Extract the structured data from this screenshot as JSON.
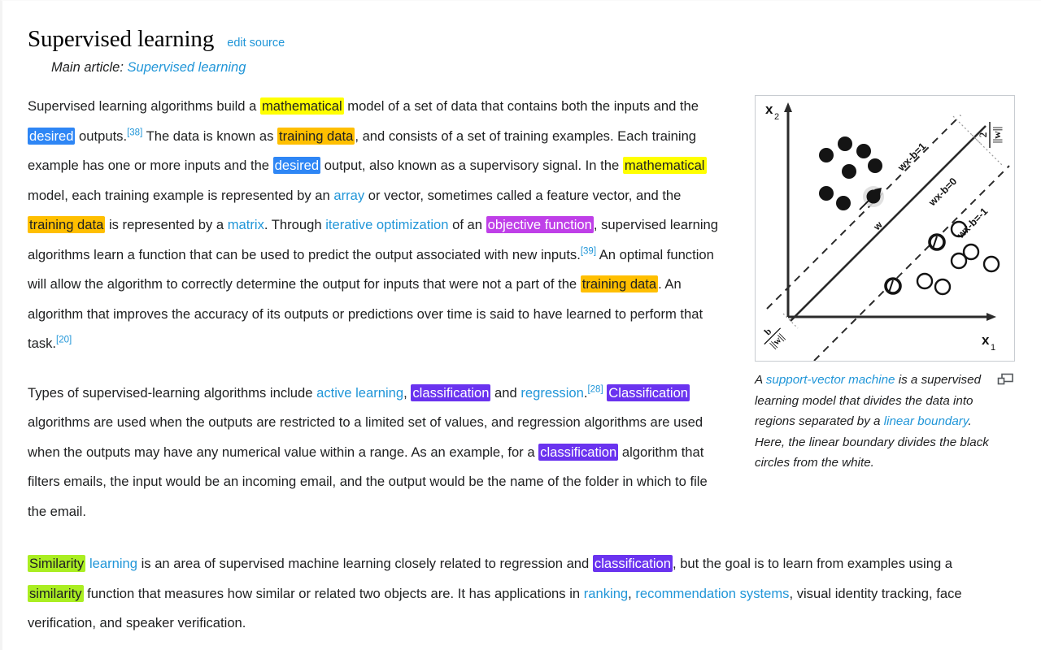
{
  "section": {
    "title": "Supervised learning",
    "edit_link": "edit source",
    "hatnote_prefix": "Main article:",
    "hatnote_link": "Supervised learning"
  },
  "paragraph1": {
    "s1": "Supervised learning algorithms build a ",
    "hl_mathematical_1": "mathematical",
    "s2": " model of a set of data that contains both the inputs and the ",
    "hl_desired_1": "desired",
    "s3": " outputs.",
    "ref38": "[38]",
    "s4": " The data is known as ",
    "hl_training_data_1": "training data",
    "s5": ", and consists of a set of training examples. Each training example has one or more inputs and the ",
    "hl_desired_2": "desired",
    "s6": " output, also known as a supervisory signal. In the ",
    "hl_mathematical_2": "mathematical",
    "s7": " model, each training example is represented by an ",
    "link_array": "array",
    "s8": " or vector, sometimes called a feature vector, and the ",
    "hl_training_data_2": "training data",
    "s9": " is represented by a ",
    "link_matrix": "matrix",
    "s10": ". Through ",
    "link_iterative_optimization": "iterative optimization",
    "s11": " of an ",
    "hl_objective_function": "objective function",
    "s12": ", supervised learning algorithms learn a function that can be used to predict the output associated with new inputs.",
    "ref39": "[39]",
    "s13": " An optimal function will allow the algorithm to correctly determine the output for inputs that were not a part of the ",
    "hl_training_data_3": "training data",
    "s14": ". An algorithm that improves the accuracy of its outputs or predictions over time is said to have learned to perform that task.",
    "ref20": "[20]"
  },
  "paragraph2": {
    "s1": "Types of supervised-learning algorithms include ",
    "link_active_learning": "active learning",
    "s2": ", ",
    "hl_classification_1": "classification",
    "s3": " and ",
    "link_regression": "regression",
    "s4": ".",
    "ref28": "[28]",
    "s5": " ",
    "hl_classification_2": "Classification",
    "s6": " algorithms are used when the outputs are restricted to a limited set of values, and regression algorithms are used when the outputs may have any numerical value within a range. As an example, for a ",
    "hl_classification_3": "classification",
    "s7": " algorithm that filters emails, the input would be an incoming email, and the output would be the name of the folder in which to file the email."
  },
  "paragraph3": {
    "hl_similarity_1": "Similarity",
    "s1": " ",
    "link_learning": "learning",
    "s2": " is an area of supervised machine learning closely related to regression and ",
    "hl_classification_4": "classification",
    "s3": ", but the goal is to learn from examples using a ",
    "hl_similarity_2": "similarity",
    "s4": " function that measures how similar or related two objects are. It has applications in ",
    "link_ranking": "ranking",
    "s5": ", ",
    "link_recommendation_systems": "recommendation systems",
    "s6": ", visual identity tracking, face verification, and speaker verification."
  },
  "figure": {
    "axis_x_label": "x",
    "axis_x_sub": "1",
    "axis_y_label": "x",
    "axis_y_sub": "2",
    "line_upper": "wx-b=1",
    "line_middle": "wx-b=0",
    "line_lower": "wx-b=-1",
    "margin_label_num": "2",
    "margin_label_den": "||w||",
    "offset_label_num": "b",
    "offset_label_den": "||w||",
    "vector_label": "w",
    "magnify_icon": "enlarge-icon"
  },
  "caption": {
    "s1": "A ",
    "link_svm": "support-vector machine",
    "s2": " is a supervised learning model that divides the data into regions separated by a ",
    "link_linear_boundary": "linear boundary",
    "s3": ". Here, the linear boundary divides the black circles from the white."
  },
  "colors": {
    "link": "#2196d8",
    "text": "#202122",
    "hl_yellow": "#ffff00",
    "hl_orange": "#ffbf00",
    "hl_blue": "#2e86f5",
    "hl_magenta": "#bf3fe8",
    "hl_violet": "#6a33ef",
    "hl_green": "#aaee22",
    "frame_border": "#c8ccd1"
  }
}
